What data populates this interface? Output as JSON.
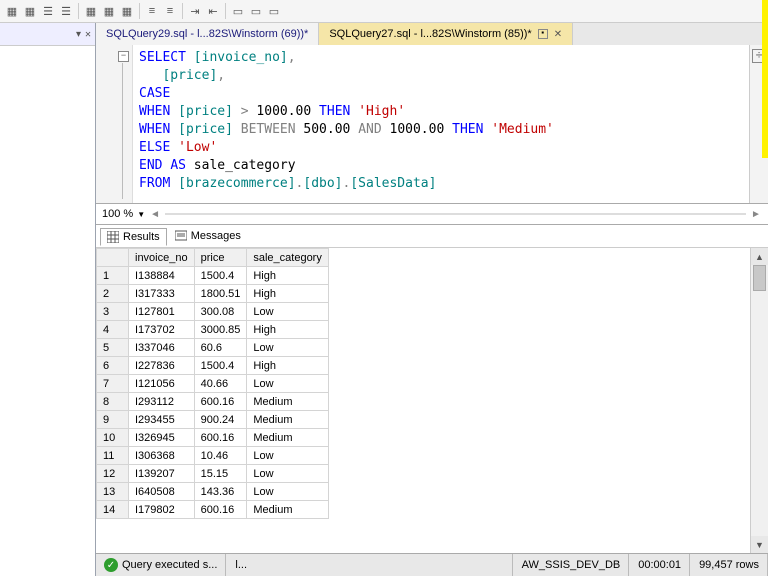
{
  "tabs": [
    "SQLQuery29.sql - l...82S\\Winstorm (69))*",
    "SQLQuery27.sql - l...82S\\Winstorm (85))*"
  ],
  "zoom": "100 %",
  "resultTabs": [
    "Results",
    "Messages"
  ],
  "sql": [
    [
      [
        "kw",
        "SELECT"
      ],
      [
        "pl",
        " "
      ],
      [
        "id",
        "[invoice_no]"
      ],
      [
        "gr",
        ","
      ]
    ],
    [
      [
        "pl",
        "   "
      ],
      [
        "id",
        "[price]"
      ],
      [
        "gr",
        ","
      ]
    ],
    [
      [
        "kw",
        "CASE"
      ]
    ],
    [
      [
        "kw",
        "WHEN"
      ],
      [
        "pl",
        " "
      ],
      [
        "id",
        "[price]"
      ],
      [
        "pl",
        " "
      ],
      [
        "gr",
        ">"
      ],
      [
        "pl",
        " "
      ],
      [
        "num",
        "1000.00"
      ],
      [
        "pl",
        " "
      ],
      [
        "kw",
        "THEN"
      ],
      [
        "pl",
        " "
      ],
      [
        "str",
        "'High'"
      ]
    ],
    [
      [
        "kw",
        "WHEN"
      ],
      [
        "pl",
        " "
      ],
      [
        "id",
        "[price]"
      ],
      [
        "pl",
        " "
      ],
      [
        "gr",
        "BETWEEN"
      ],
      [
        "pl",
        " "
      ],
      [
        "num",
        "500.00"
      ],
      [
        "pl",
        " "
      ],
      [
        "gr",
        "AND"
      ],
      [
        "pl",
        " "
      ],
      [
        "num",
        "1000.00"
      ],
      [
        "pl",
        " "
      ],
      [
        "kw",
        "THEN"
      ],
      [
        "pl",
        " "
      ],
      [
        "str",
        "'Medium'"
      ]
    ],
    [
      [
        "kw",
        "ELSE"
      ],
      [
        "pl",
        " "
      ],
      [
        "str",
        "'Low'"
      ]
    ],
    [
      [
        "kw",
        "END"
      ],
      [
        "pl",
        " "
      ],
      [
        "kw",
        "AS"
      ],
      [
        "pl",
        " sale_category"
      ]
    ],
    [
      [
        "kw",
        "FROM"
      ],
      [
        "pl",
        " "
      ],
      [
        "id",
        "[brazecommerce]"
      ],
      [
        "gr",
        "."
      ],
      [
        "id",
        "[dbo]"
      ],
      [
        "gr",
        "."
      ],
      [
        "id",
        "[SalesData]"
      ]
    ]
  ],
  "columns": [
    "invoice_no",
    "price",
    "sale_category"
  ],
  "rows": [
    [
      "I138884",
      "1500.4",
      "High"
    ],
    [
      "I317333",
      "1800.51",
      "High"
    ],
    [
      "I127801",
      "300.08",
      "Low"
    ],
    [
      "I173702",
      "3000.85",
      "High"
    ],
    [
      "I337046",
      "60.6",
      "Low"
    ],
    [
      "I227836",
      "1500.4",
      "High"
    ],
    [
      "I121056",
      "40.66",
      "Low"
    ],
    [
      "I293112",
      "600.16",
      "Medium"
    ],
    [
      "I293455",
      "900.24",
      "Medium"
    ],
    [
      "I326945",
      "600.16",
      "Medium"
    ],
    [
      "I306368",
      "10.46",
      "Low"
    ],
    [
      "I139207",
      "15.15",
      "Low"
    ],
    [
      "I640508",
      "143.36",
      "Low"
    ],
    [
      "I179802",
      "600.16",
      "Medium"
    ]
  ],
  "status": {
    "exec": "Query executed s...",
    "server": "l...",
    "db": "AW_SSIS_DEV_DB",
    "time": "00:00:01",
    "rows": "99,457 rows"
  }
}
